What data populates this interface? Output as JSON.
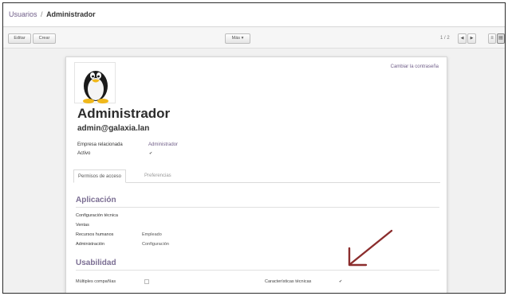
{
  "breadcrumb": {
    "parent": "Usuarios",
    "separator": "/",
    "current": "Administrador"
  },
  "toolbar": {
    "edit_label": "Editar",
    "create_label": "Crear",
    "more_label": "Más ▾",
    "pager_text": "1 / 2",
    "prev_icon": "left-arrow-icon",
    "next_icon": "right-arrow-icon",
    "list_view_icon": "list-view-icon",
    "form_view_icon": "form-view-icon"
  },
  "form": {
    "avatar_icon": "tux-penguin-icon",
    "change_password_link": "Cambiar la contraseña",
    "name": "Administrador",
    "login": "admin@galaxia.lan",
    "fields": [
      {
        "label": "Empresa relacionada",
        "value": "Administrador"
      },
      {
        "label": "Activo",
        "value": "✔"
      }
    ]
  },
  "tabs": [
    {
      "label": "Permisos de acceso"
    },
    {
      "label": "Preferencias"
    }
  ],
  "sections": {
    "application": {
      "title": "Aplicación",
      "rows": [
        {
          "label": "Configuración técnica",
          "value": ""
        },
        {
          "label": "Ventas",
          "value": ""
        },
        {
          "label": "Recursos humanos",
          "value": "Empleado"
        },
        {
          "label": "Administración",
          "value": "Configuración"
        }
      ]
    },
    "usability": {
      "title": "Usabilidad",
      "multi_company_label": "Múltiples compañías",
      "technical_features_label": "Características técnicas",
      "technical_features_checked": "✔"
    }
  },
  "colors": {
    "accent": "#6f5d88",
    "annotation_arrow": "#8b2d2d"
  }
}
